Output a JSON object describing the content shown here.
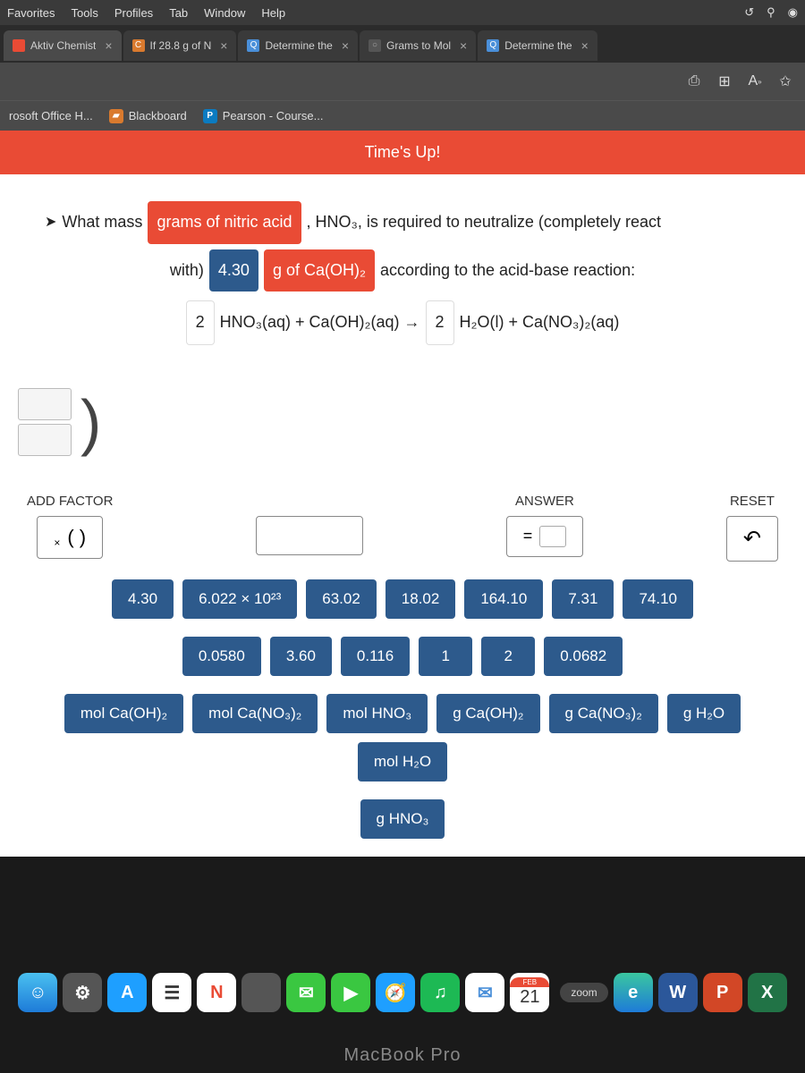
{
  "menu": {
    "items": [
      "Favorites",
      "Tools",
      "Profiles",
      "Tab",
      "Window",
      "Help"
    ],
    "right_icons": [
      "history",
      "bluetooth",
      "camera"
    ]
  },
  "tabs": [
    {
      "label": "Aktiv Chemist",
      "icon_color": "#e94b35"
    },
    {
      "label": "If 28.8 g of N",
      "icon_color": "#d97a2e",
      "icon_text": "C"
    },
    {
      "label": "Determine the",
      "icon_color": "#4a8fd9",
      "icon_text": "Q"
    },
    {
      "label": "Grams to Mol",
      "icon_color": "#555",
      "icon_text": "○"
    },
    {
      "label": "Determine the",
      "icon_color": "#4a8fd9",
      "icon_text": "Q"
    }
  ],
  "toolbar_icons": [
    "screenshot",
    "grid",
    "text",
    "favorite"
  ],
  "bookmarks": [
    {
      "label": "rosoft Office H...",
      "icon_bg": "#ccc"
    },
    {
      "label": "Blackboard",
      "icon_bg": "#d97a2e"
    },
    {
      "label": "Pearson - Course...",
      "icon_bg": "#0b7bc1",
      "icon_text": "P"
    }
  ],
  "banner": "Time's Up!",
  "question": {
    "l1_pre": "What mass",
    "l1_chip": "grams of nitric acid",
    "l1_post": ", HNO₃, is required to neutralize (completely react",
    "l2_pre": "with)",
    "l2_chip1": "4.30",
    "l2_chip2": "g of Ca(OH)₂",
    "l2_post": "according to the acid-base reaction:",
    "eq_c1": "2",
    "eq_t1": "HNO₃(aq) + Ca(OH)₂(aq) →",
    "eq_c2": "2",
    "eq_t2": "H₂O(l) + Ca(NO₃)₂(aq)"
  },
  "controls": {
    "add_factor": "ADD FACTOR",
    "factor_content": "( )",
    "answer": "ANSWER",
    "answer_eq": "=",
    "reset": "RESET"
  },
  "tiles_row1": [
    "4.30",
    "6.022 × 10²³",
    "63.02",
    "18.02",
    "164.10",
    "7.31",
    "74.10"
  ],
  "tiles_row2": [
    "0.0580",
    "3.60",
    "0.116",
    "1",
    "2",
    "0.0682"
  ],
  "tiles_row3": [
    "mol Ca(OH)₂",
    "mol Ca(NO₃)₂",
    "mol HNO₃",
    "g Ca(OH)₂",
    "g Ca(NO₃)₂",
    "g H₂O",
    "mol H₂O"
  ],
  "tiles_row4": [
    "g HNO₃"
  ],
  "dock": {
    "cal_month": "FEB",
    "cal_day": "21",
    "zoom": "zoom"
  },
  "laptop": "MacBook Pro"
}
